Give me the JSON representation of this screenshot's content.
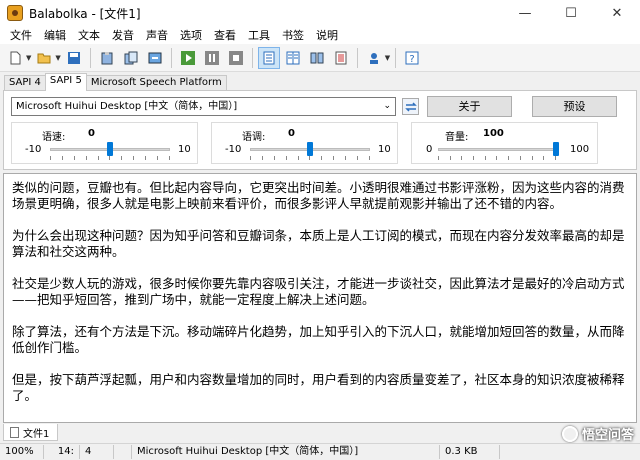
{
  "window": {
    "title": "Balabolka - [文件1]"
  },
  "menu": [
    "文件",
    "编辑",
    "文本",
    "发音",
    "声音",
    "选项",
    "查看",
    "工具",
    "书签",
    "说明"
  ],
  "tabs": [
    "SAPI 4",
    "SAPI 5",
    "Microsoft Speech Platform"
  ],
  "voice": {
    "selected": "Microsoft Huihui Desktop [中文（简体，中国）]",
    "about_label": "关于",
    "preset_label": "预设"
  },
  "sliders": {
    "rate": {
      "label": "语速:",
      "value": "0",
      "min": "-10",
      "max": "10",
      "level": 0.5
    },
    "pitch": {
      "label": "语调:",
      "value": "0",
      "min": "-10",
      "max": "10",
      "level": 0.5
    },
    "volume": {
      "label": "音量:",
      "value": "100",
      "min": "0",
      "max": "100",
      "level": 1.0
    }
  },
  "editor": {
    "paragraphs": [
      "类似的问题，豆瓣也有。但比起内容导向，它更突出时间差。小透明很难通过书影评涨粉，因为这些内容的消费场景更明确，很多人就是电影上映前来看评价，而很多影评人早就提前观影并输出了还不错的内容。",
      "为什么会出现这种问题？因为知乎问答和豆瓣词条，本质上是人工订阅的模式，而现在内容分发效率最高的却是算法和社交这两种。",
      "社交是少数人玩的游戏，很多时候你要先靠内容吸引关注，才能进一步谈社交，因此算法才是最好的冷启动方式——把知乎短回答，推到广场中，就能一定程度上解决上述问题。",
      "除了算法，还有个方法是下沉。移动端碎片化趋势，加上知乎引入的下沉人口，就能增加短回答的数量，从而降低创作门槛。",
      "但是，按下葫芦浮起瓢，用户和内容数量增加的同时，用户看到的内容质量变差了，社区本身的知识浓度被稀释了。"
    ]
  },
  "doc_tabs": [
    "文件1"
  ],
  "status": {
    "zoom": "100%",
    "line": "14:",
    "col": "4",
    "voice": "Microsoft Huihui Desktop [中文（简体，中国）]",
    "size": "0.3 KB"
  },
  "watermark": "悟空问答"
}
